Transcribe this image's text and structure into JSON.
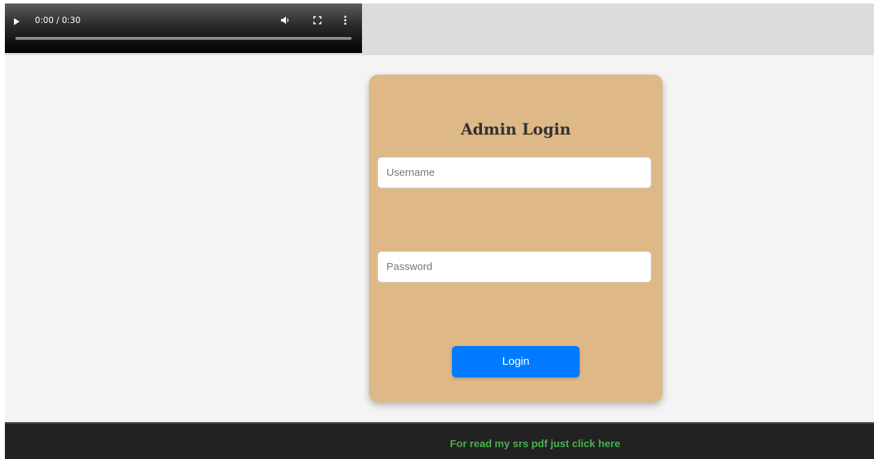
{
  "video": {
    "time": "0:00 / 0:30",
    "progress": 0,
    "icons": [
      "play-icon",
      "volume-icon",
      "fullscreen-icon",
      "more-options-icon"
    ]
  },
  "login": {
    "title": "Admin Login",
    "username_placeholder": "Username",
    "username_value": "",
    "password_placeholder": "Password",
    "password_value": "",
    "button_label": "Login"
  },
  "footer": {
    "link_text": "For read my srs pdf just click here"
  },
  "colors": {
    "card_background": "#deb887",
    "button": "#007bff",
    "footer_background": "#222222",
    "footer_link": "#4caf50"
  }
}
